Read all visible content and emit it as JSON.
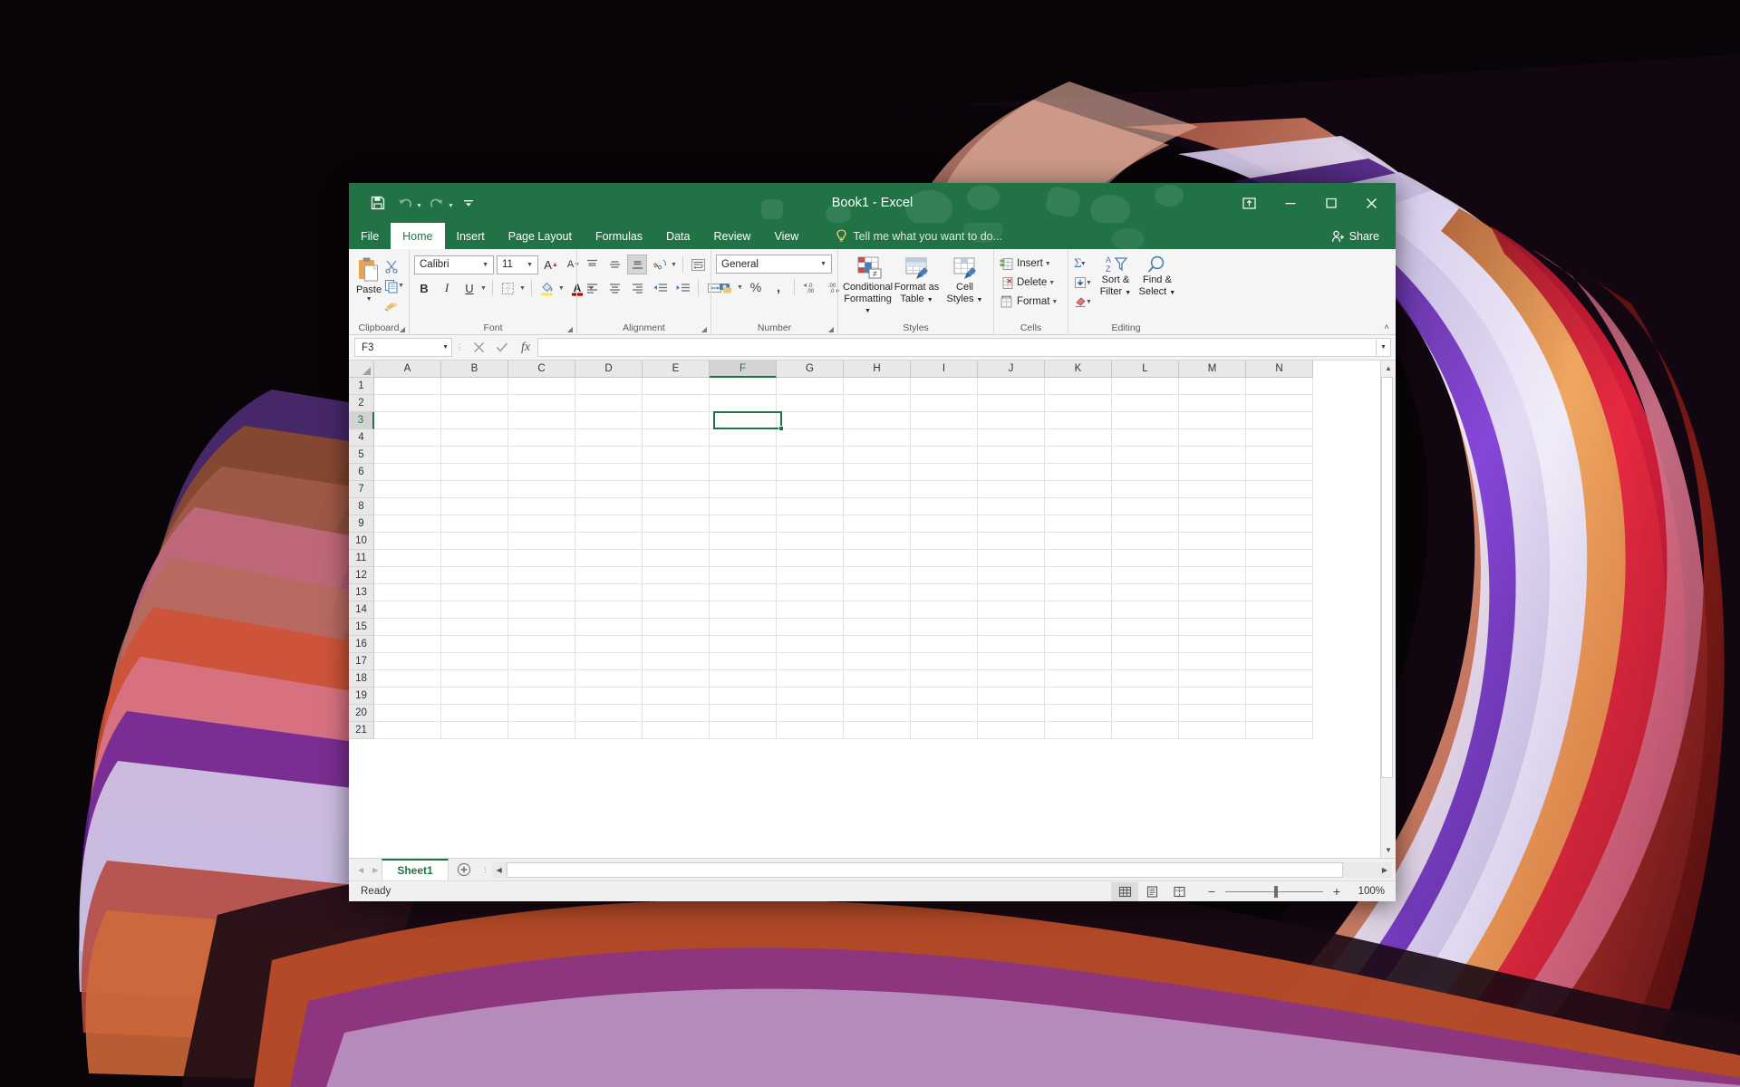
{
  "desktop": {
    "wallpaper_name": "abstract-flowing-ribbons",
    "background_color": "#080407"
  },
  "window": {
    "title": "Book1 - Excel",
    "quick_access": [
      {
        "name": "save",
        "icon": "save-icon",
        "label": "Save"
      },
      {
        "name": "undo",
        "icon": "undo-icon",
        "label": "Undo"
      },
      {
        "name": "redo",
        "icon": "redo-icon",
        "label": "Redo"
      },
      {
        "name": "customize",
        "icon": "customize-qat-icon",
        "label": "Customize Quick Access Toolbar"
      }
    ],
    "controls": {
      "ribbon_display": "Ribbon Display Options",
      "minimize": "Minimize",
      "maximize": "Maximize",
      "close": "Close"
    },
    "accent_color": "#217346"
  },
  "tabs": {
    "items": [
      {
        "label": "File",
        "active": false
      },
      {
        "label": "Home",
        "active": true
      },
      {
        "label": "Insert",
        "active": false
      },
      {
        "label": "Page Layout",
        "active": false
      },
      {
        "label": "Formulas",
        "active": false
      },
      {
        "label": "Data",
        "active": false
      },
      {
        "label": "Review",
        "active": false
      },
      {
        "label": "View",
        "active": false
      }
    ],
    "tell_me": "Tell me what you want to do...",
    "share": "Share"
  },
  "ribbon": {
    "clipboard": {
      "label": "Clipboard",
      "paste": "Paste",
      "cut": "Cut",
      "copy": "Copy",
      "format_painter": "Format Painter"
    },
    "font": {
      "label": "Font",
      "font_name": "Calibri",
      "font_size": "11",
      "grow_font": "Increase Font Size",
      "shrink_font": "Decrease Font Size",
      "bold": "B",
      "italic": "I",
      "underline": "U",
      "borders": "Borders",
      "fill_color": "Fill Color",
      "font_color": "Font Color"
    },
    "alignment": {
      "label": "Alignment",
      "top_align": "Top Align",
      "middle_align": "Middle Align",
      "bottom_align": "Bottom Align",
      "orientation": "Orientation",
      "wrap_text": "Wrap Text",
      "align_left": "Align Left",
      "center": "Center",
      "align_right": "Align Right",
      "decrease_indent": "Decrease Indent",
      "increase_indent": "Increase Indent",
      "merge_center": "Merge & Center"
    },
    "number": {
      "label": "Number",
      "format": "General",
      "accounting": "Accounting Number Format",
      "percent": "%",
      "comma": ",",
      "increase_decimal": "Increase Decimal",
      "decrease_decimal": "Decrease Decimal"
    },
    "styles": {
      "label": "Styles",
      "conditional_formatting": [
        "Conditional",
        "Formatting"
      ],
      "format_as_table": [
        "Format as",
        "Table"
      ],
      "cell_styles": [
        "Cell",
        "Styles"
      ]
    },
    "cells": {
      "label": "Cells",
      "insert": "Insert",
      "delete": "Delete",
      "format": "Format"
    },
    "editing": {
      "label": "Editing",
      "autosum": "AutoSum",
      "fill": "Fill",
      "clear": "Clear",
      "sort_filter": [
        "Sort &",
        "Filter"
      ],
      "find_select": [
        "Find &",
        "Select"
      ]
    },
    "collapse": "Collapse the Ribbon"
  },
  "formula_bar": {
    "name_box": "F3",
    "cancel": "Cancel",
    "enter": "Enter",
    "insert_function": "fx",
    "formula_value": "",
    "expand": "Expand Formula Bar"
  },
  "grid": {
    "columns": [
      "A",
      "B",
      "C",
      "D",
      "E",
      "F",
      "G",
      "H",
      "I",
      "J",
      "K",
      "L",
      "M",
      "N"
    ],
    "rows": [
      1,
      2,
      3,
      4,
      5,
      6,
      7,
      8,
      9,
      10,
      11,
      12,
      13,
      14,
      15,
      16,
      17,
      18,
      19,
      20,
      21
    ],
    "selected_cell": "F3",
    "selected_column": "F",
    "selected_row": 3,
    "selection_color": "#217346"
  },
  "sheet_bar": {
    "first_sheet": "First Sheet",
    "previous_sheet": "Previous Sheet",
    "sheets": [
      {
        "name": "Sheet1",
        "active": true
      }
    ],
    "add_sheet": "New sheet"
  },
  "status_bar": {
    "status": "Ready",
    "views": [
      {
        "name": "normal",
        "label": "Normal",
        "active": true
      },
      {
        "name": "page-layout",
        "label": "Page Layout",
        "active": false
      },
      {
        "name": "page-break-preview",
        "label": "Page Break Preview",
        "active": false
      }
    ],
    "zoom_out": "−",
    "zoom_in": "+",
    "zoom_level": "100%"
  }
}
